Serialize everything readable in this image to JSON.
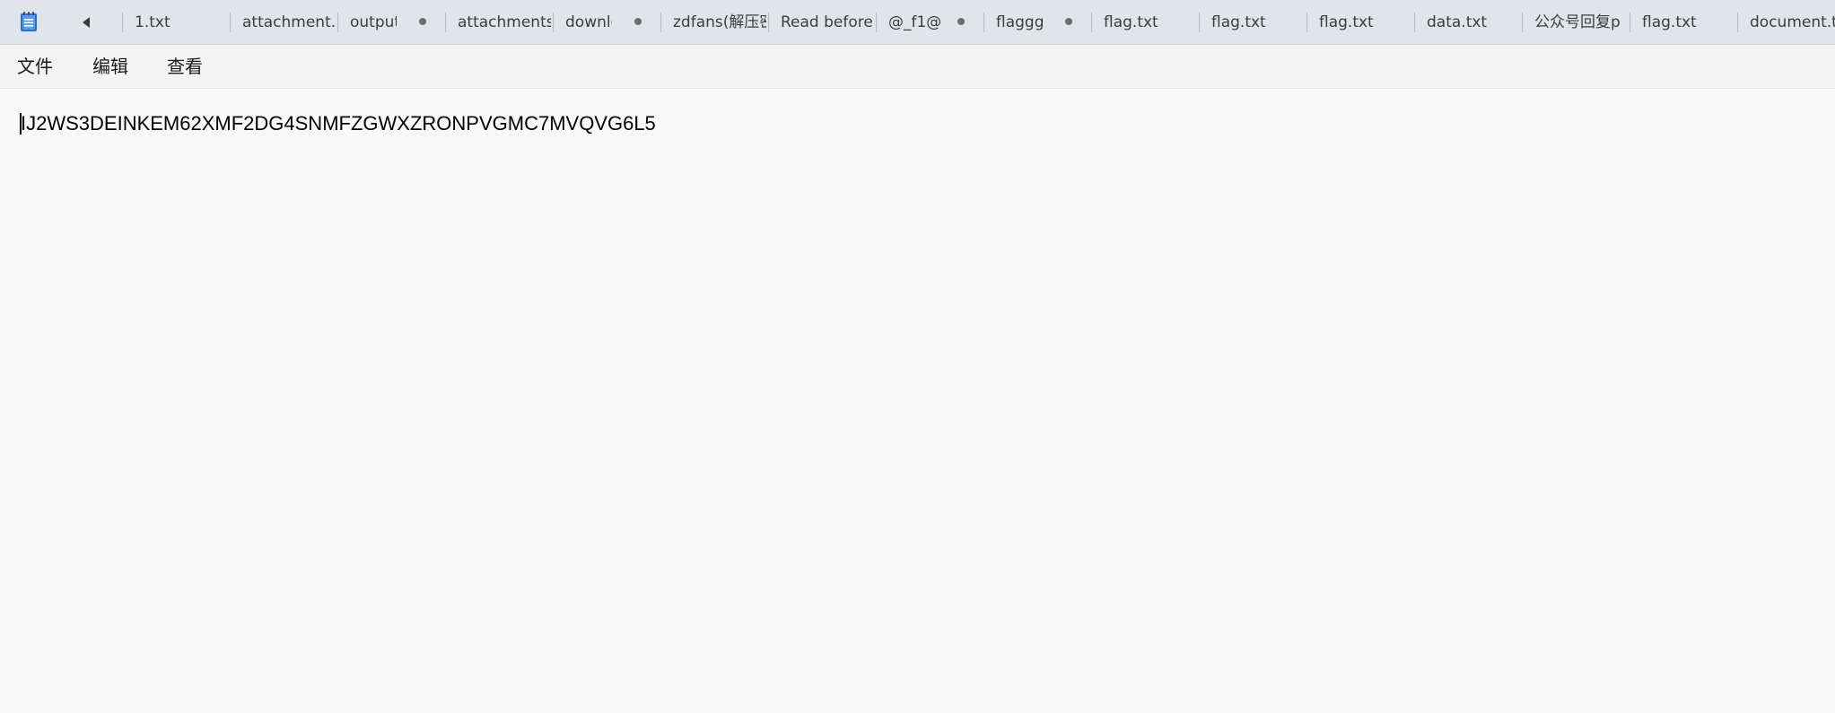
{
  "app": {
    "icon": "notepad-icon",
    "back_icon": "chevron-left-icon"
  },
  "tabs": [
    {
      "label": "1.txt",
      "modified": false
    },
    {
      "label": "attachment.txt",
      "modified": false
    },
    {
      "label": "output",
      "modified": true
    },
    {
      "label": "attachments",
      "modified": false
    },
    {
      "label": "download",
      "modified": true
    },
    {
      "label": "zdfans(解压密码)",
      "modified": false
    },
    {
      "label": "Read before",
      "modified": false
    },
    {
      "label": "@_f1@",
      "modified": true
    },
    {
      "label": "flaggg",
      "modified": true
    },
    {
      "label": "flag.txt",
      "modified": false
    },
    {
      "label": "flag.txt",
      "modified": false
    },
    {
      "label": "flag.txt",
      "modified": false
    },
    {
      "label": "data.txt",
      "modified": false
    },
    {
      "label": "公众号回复p",
      "modified": false
    },
    {
      "label": "flag.txt",
      "modified": false
    },
    {
      "label": "document.txt",
      "modified": false
    }
  ],
  "menu": {
    "file": "文件",
    "edit": "编辑",
    "view": "查看"
  },
  "editor": {
    "text": "IJ2WS3DEINKEM62XMF2DG4SNMFZGWXZRONPVGMC7MVQVG6L5"
  },
  "colors": {
    "tabbar_bg": "#e1e5ea",
    "menubar_bg": "#f3f3f3",
    "editor_bg": "#f9f9f9",
    "app_icon_blue": "#2b6fc7"
  }
}
